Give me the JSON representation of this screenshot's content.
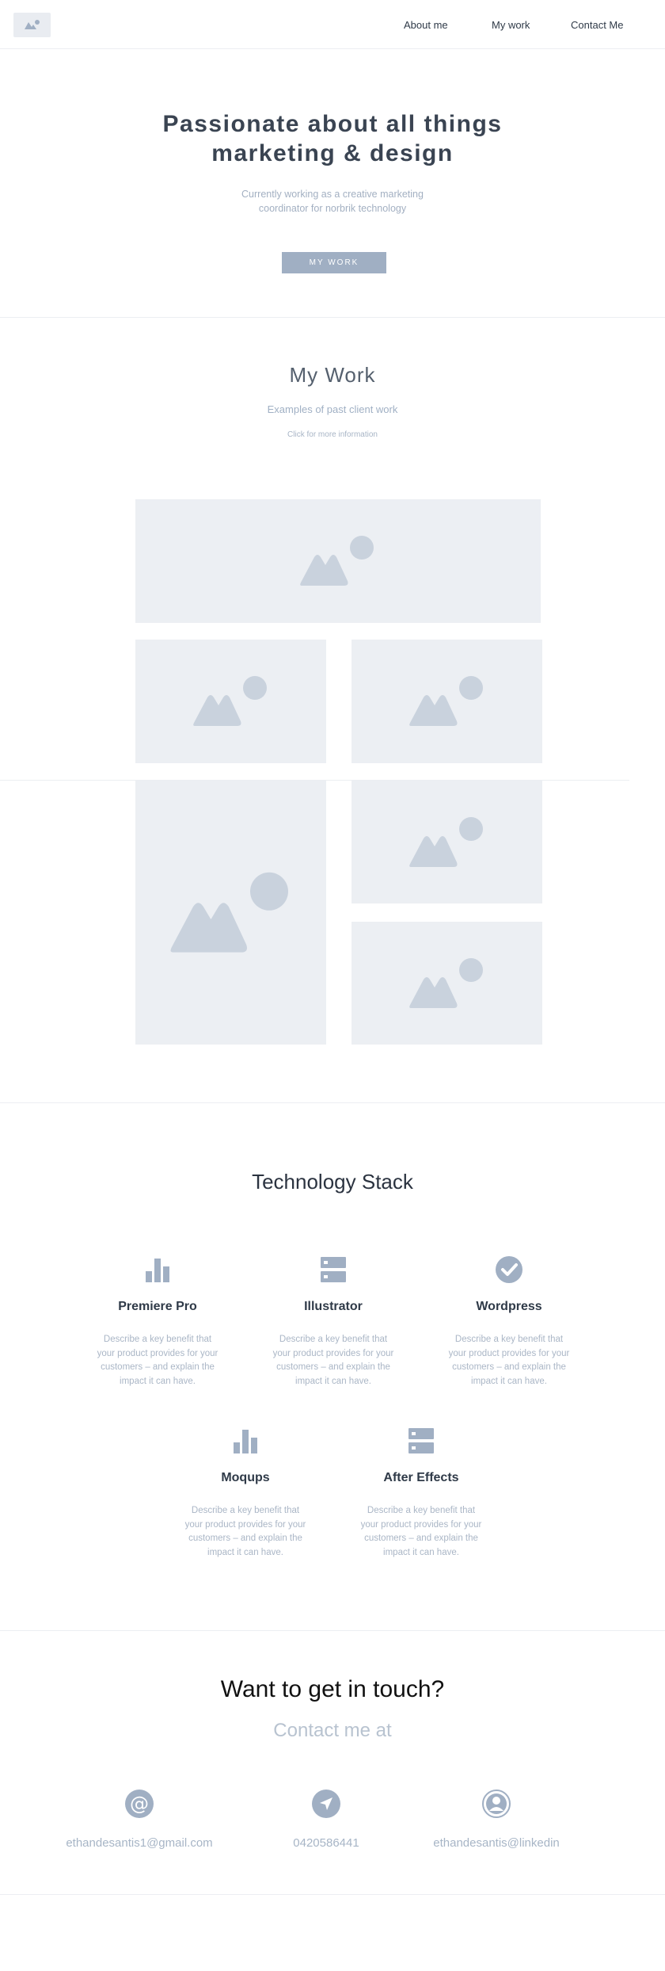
{
  "nav": {
    "logo_icon": "image-placeholder-icon",
    "links": [
      {
        "label": "About me"
      },
      {
        "label": "My work"
      },
      {
        "label": "Contact Me"
      }
    ]
  },
  "hero": {
    "title_line1": "Passionate about all things",
    "title_line2": "marketing & design",
    "subtitle_line1": "Currently working as a creative marketing",
    "subtitle_line2": "coordinator for norbrik technology",
    "button_label": "MY WORK"
  },
  "work": {
    "title": "My Work",
    "subtitle": "Examples of past client work",
    "note": "Click for more information",
    "placeholder_icon": "image-placeholder-icon",
    "items_count": 6
  },
  "tech": {
    "title": "Technology Stack",
    "items": [
      {
        "name": "Premiere Pro",
        "icon": "bar-chart-icon",
        "desc": [
          "Describe a key benefit that",
          "your product provides for your",
          "customers – and explain the",
          "impact it can have."
        ]
      },
      {
        "name": "Illustrator",
        "icon": "server-icon",
        "desc": [
          "Describe a key benefit that",
          "your product provides for your",
          "customers – and explain the",
          "impact it can have."
        ]
      },
      {
        "name": "Wordpress",
        "icon": "check-circle-icon",
        "desc": [
          "Describe a key benefit that",
          "your product provides for your",
          "customers – and explain the",
          "impact it can have."
        ]
      },
      {
        "name": "Moqups",
        "icon": "bar-chart-icon",
        "desc": [
          "Describe a key benefit that",
          "your product provides for your",
          "customers – and explain the",
          "impact it can have."
        ]
      },
      {
        "name": "After Effects",
        "icon": "server-icon",
        "desc": [
          "Describe a key benefit that",
          "your product provides for your",
          "customers – and explain the",
          "impact it can have."
        ]
      }
    ]
  },
  "contact": {
    "title": "Want to get in touch?",
    "subtitle": "Contact me at",
    "items": [
      {
        "icon": "at-sign-icon",
        "text": "ethandesantis1@gmail.com"
      },
      {
        "icon": "location-arrow-icon",
        "text": "0420586441"
      },
      {
        "icon": "user-icon",
        "text": "ethandesantis@linkedin"
      }
    ]
  },
  "colors": {
    "accent": "#a0afc3",
    "placeholder_bg": "#eceff3",
    "placeholder_fg": "#c9d2dd",
    "text_dark": "#3a4452",
    "text_muted": "#aab6c6"
  }
}
